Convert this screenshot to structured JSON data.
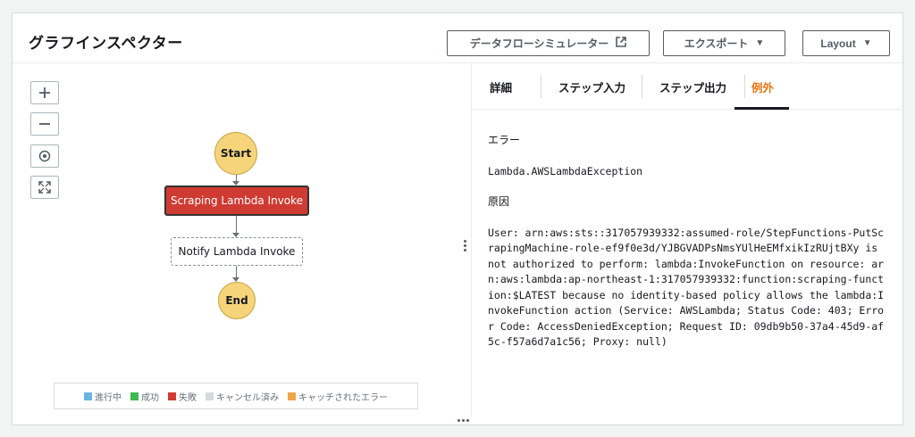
{
  "header": {
    "title": "グラフインスペクター",
    "simulator_label": "データフローシミュレーター",
    "export_label": "エクスポート",
    "layout_label": "Layout"
  },
  "graph": {
    "controls": [
      "zoom-in",
      "zoom-out",
      "center",
      "fit"
    ],
    "nodes": {
      "start": "Start",
      "scraping": "Scraping Lambda Invoke",
      "notify": "Notify Lambda Invoke",
      "end": "End"
    },
    "legend": [
      {
        "label": "進行中",
        "color": "#6cb4e4"
      },
      {
        "label": "成功",
        "color": "#3fb950"
      },
      {
        "label": "失敗",
        "color": "#cf3b32"
      },
      {
        "label": "キャンセル済み",
        "color": "#d5dbdb"
      },
      {
        "label": "キャッチされたエラー",
        "color": "#f0a54a"
      }
    ]
  },
  "tabs": {
    "details": "詳細",
    "step_input": "ステップ入力",
    "step_output": "ステップ出力",
    "exception": "例外"
  },
  "exception": {
    "error_label": "エラー",
    "error_value": "Lambda.AWSLambdaException",
    "cause_label": "原因",
    "cause_value": "User: arn:aws:sts::317057939332:assumed-role/StepFunctions-PutScrapingMachine-role-ef9f0e3d/YJBGVADPsNmsYUlHeEMfxikIzRUjtBXy is not authorized to perform: lambda:InvokeFunction on resource: arn:aws:lambda:ap-northeast-1:317057939332:function:scraping-function:$LATEST because no identity-based policy allows the lambda:InvokeFunction action (Service: AWSLambda; Status Code: 403; Error Code: AccessDeniedException; Request ID: 09db9b50-37a4-45d9-af5c-f57a6d7a1c56; Proxy: null)"
  }
}
